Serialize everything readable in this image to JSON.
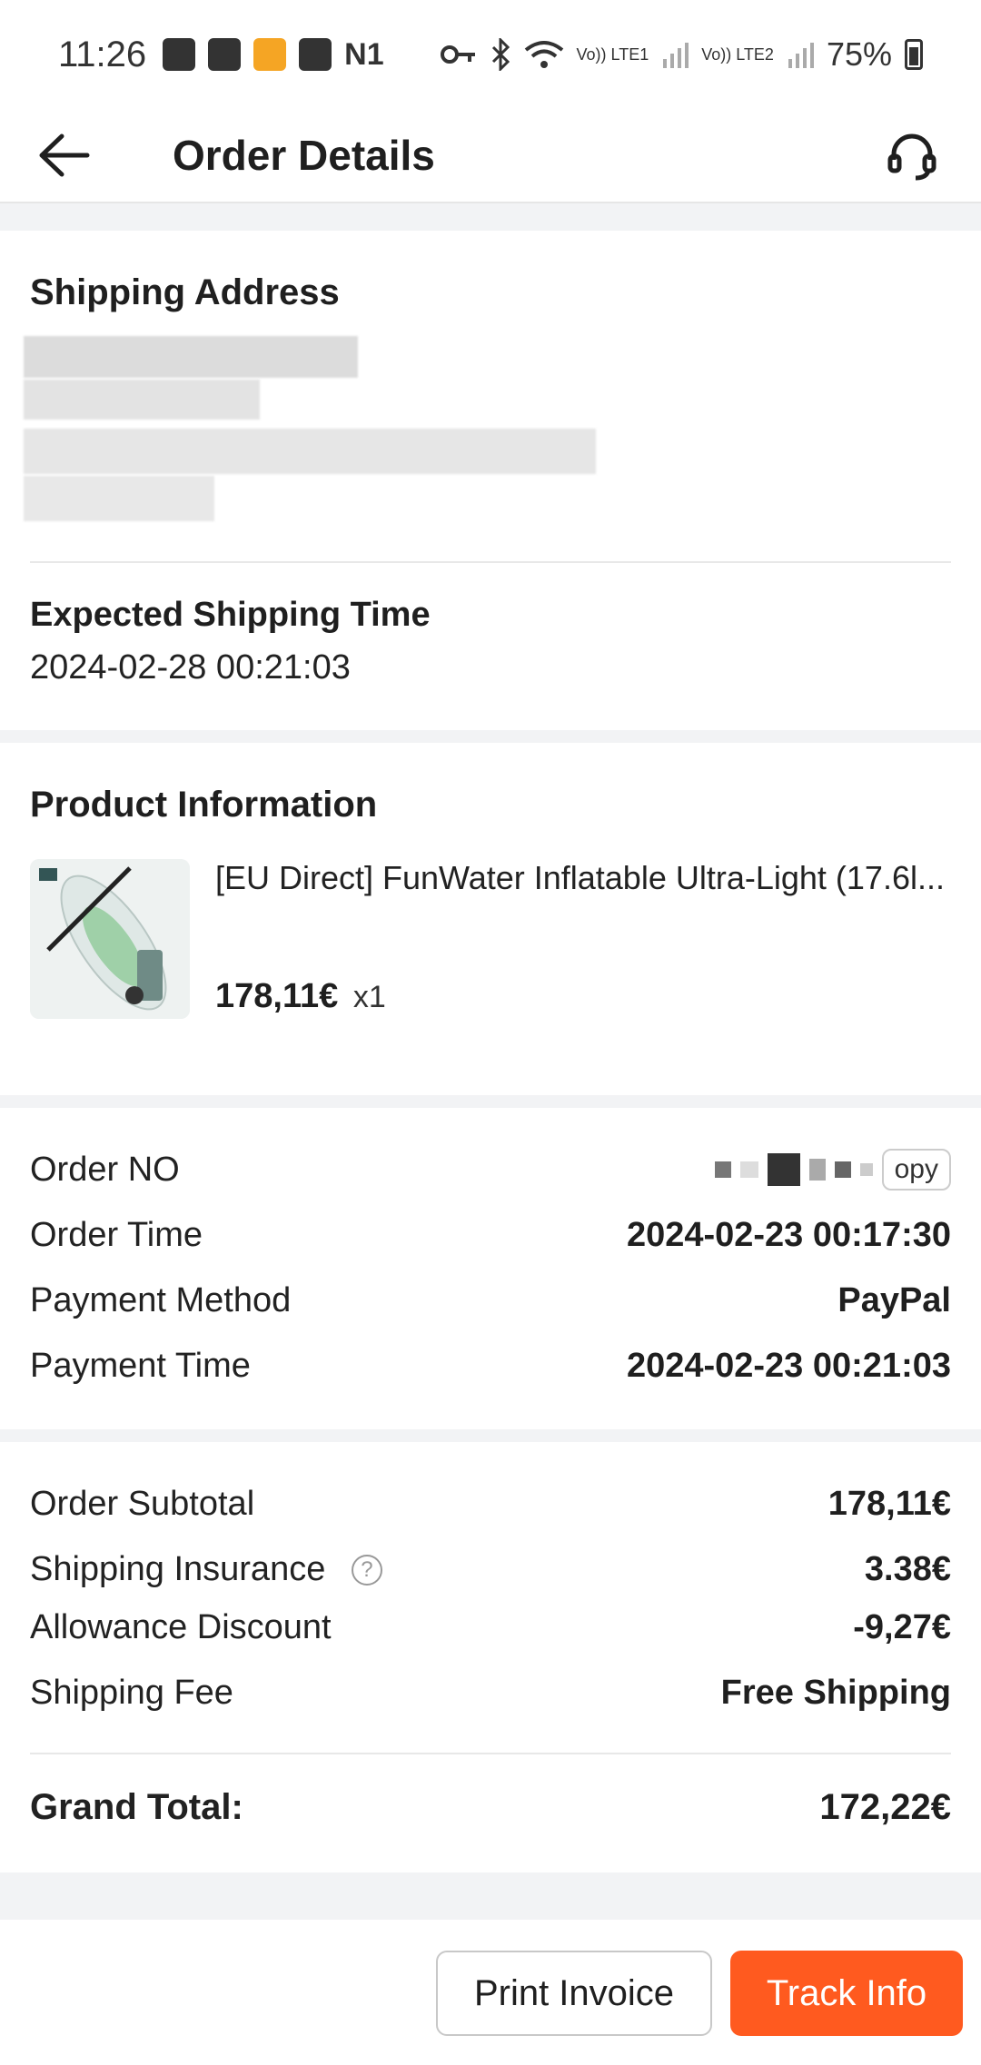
{
  "status_bar": {
    "time": "11:26",
    "carrier_text": "N1",
    "sim1_label": "Vo)) LTE1",
    "sim2_label": "Vo)) LTE2",
    "battery": "75%"
  },
  "header": {
    "title": "Order Details"
  },
  "shipping": {
    "section_title": "Shipping Address",
    "expected_label": "Expected Shipping Time",
    "expected_value": "2024-02-28 00:21:03"
  },
  "product": {
    "section_title": "Product Information",
    "name": "[EU Direct] FunWater Inflatable Ultra-Light (17.6l...",
    "price": "178,11€",
    "quantity": "x1"
  },
  "order_info": {
    "order_no_label": "Order NO",
    "copy_label": "opy",
    "order_time_label": "Order Time",
    "order_time_value": "2024-02-23 00:17:30",
    "payment_method_label": "Payment Method",
    "payment_method_value": "PayPal",
    "payment_time_label": "Payment Time",
    "payment_time_value": "2024-02-23 00:21:03"
  },
  "totals": {
    "subtotal_label": "Order Subtotal",
    "subtotal_value": "178,11€",
    "insurance_label": "Shipping Insurance",
    "insurance_help": "?",
    "insurance_value": "3.38€",
    "discount_label": "Allowance Discount",
    "discount_value": "-9,27€",
    "fee_label": "Shipping Fee",
    "fee_value": "Free Shipping",
    "grand_label": "Grand Total:",
    "grand_value": "172,22€"
  },
  "actions": {
    "print_invoice": "Print Invoice",
    "track_info": "Track Info"
  },
  "colors": {
    "accent": "#ff5a1f"
  }
}
